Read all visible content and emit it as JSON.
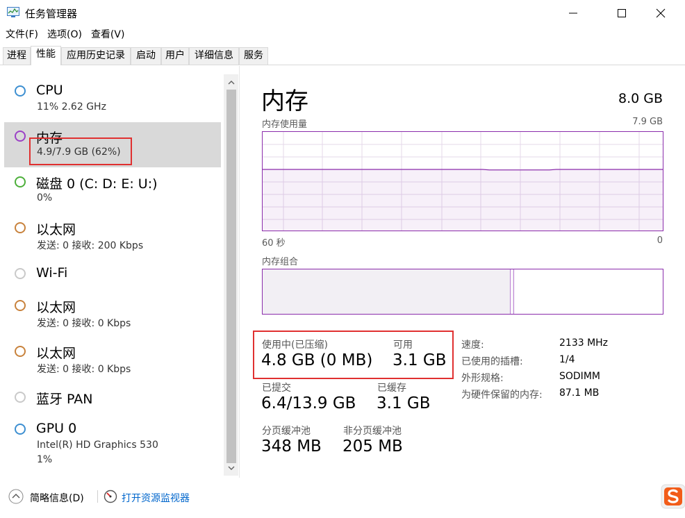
{
  "window": {
    "title": "任务管理器",
    "controls": [
      "minimize",
      "maximize",
      "close"
    ]
  },
  "menu": [
    "文件(F)",
    "选项(O)",
    "查看(V)"
  ],
  "tabs": [
    {
      "label": "进程",
      "active": false
    },
    {
      "label": "性能",
      "active": true
    },
    {
      "label": "应用历史记录",
      "active": false
    },
    {
      "label": "启动",
      "active": false
    },
    {
      "label": "用户",
      "active": false
    },
    {
      "label": "详细信息",
      "active": false
    },
    {
      "label": "服务",
      "active": false
    }
  ],
  "sidebar": {
    "items": [
      {
        "title": "CPU",
        "sub1": "11% 2.62 GHz",
        "sub2": "",
        "color": "#3d8fd1",
        "selected": false
      },
      {
        "title": "内存",
        "sub1": "4.9/7.9 GB (62%)",
        "sub2": "",
        "color": "#9b40c6",
        "selected": true
      },
      {
        "title": "磁盘 0 (C: D: E: U:)",
        "sub1": "0%",
        "sub2": "",
        "color": "#4caf3a",
        "selected": false
      },
      {
        "title": "以太网",
        "sub1": "发送: 0 接收: 200 Kbps",
        "sub2": "",
        "color": "#c8823c",
        "selected": false
      },
      {
        "title": "Wi-Fi",
        "sub1": "",
        "sub2": "",
        "color": "#c9c9c9",
        "selected": false
      },
      {
        "title": "以太网",
        "sub1": "发送: 0 接收: 0 Kbps",
        "sub2": "",
        "color": "#c8823c",
        "selected": false
      },
      {
        "title": "以太网",
        "sub1": "发送: 0 接收: 0 Kbps",
        "sub2": "",
        "color": "#c8823c",
        "selected": false
      },
      {
        "title": "蓝牙 PAN",
        "sub1": "",
        "sub2": "",
        "color": "#c9c9c9",
        "selected": false
      },
      {
        "title": "GPU 0",
        "sub1": "Intel(R) HD Graphics 530",
        "sub2": "1%",
        "color": "#3d8fd1",
        "selected": false
      }
    ]
  },
  "detail": {
    "title": "内存",
    "total": "8.0 GB",
    "usage_label": "内存使用量",
    "usage_max": "7.9 GB",
    "time_left": "60 秒",
    "time_right": "0",
    "composition_label": "内存组合",
    "usage_fraction": 0.62,
    "stats": {
      "in_use_label": "使用中(已压缩)",
      "in_use_value": "4.8 GB (0 MB)",
      "available_label": "可用",
      "available_value": "3.1 GB",
      "committed_label": "已提交",
      "committed_value": "6.4/13.9 GB",
      "cached_label": "已缓存",
      "cached_value": "3.1 GB",
      "paged_label": "分页缓冲池",
      "paged_value": "348 MB",
      "nonpaged_label": "非分页缓冲池",
      "nonpaged_value": "205 MB"
    },
    "info": [
      {
        "label": "速度:",
        "value": "2133 MHz"
      },
      {
        "label": "已使用的插槽:",
        "value": "1/4"
      },
      {
        "label": "外形规格:",
        "value": "SODIMM"
      },
      {
        "label": "为硬件保留的内存:",
        "value": "87.1 MB"
      }
    ]
  },
  "footer": {
    "summary_label": "简略信息(D)",
    "monitor_label": "打开资源监视器"
  },
  "colors": {
    "memory_accent": "#8a2bab",
    "highlight_red": "#e03030",
    "link_blue": "#0066cc"
  }
}
